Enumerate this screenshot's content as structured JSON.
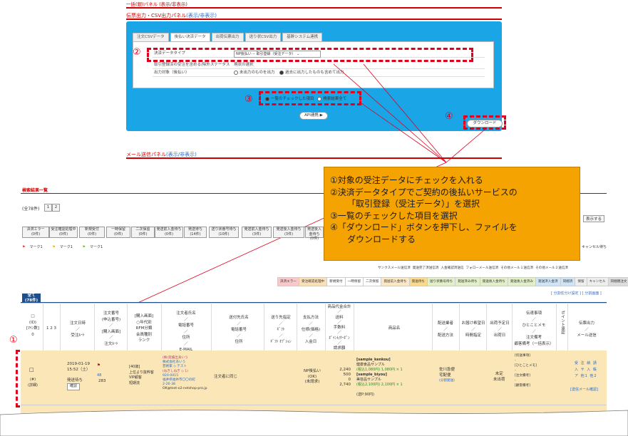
{
  "panels": {
    "top_panel_title": "一括(銀)パネル (表示/非表示)",
    "settle_panel_title": "伝票出力・CSV出力パネル",
    "settle_panel_toggle": "(表示/非表示)",
    "mail_panel_title": "メール送信パネル",
    "mail_panel_toggle": "(表示/非表示)"
  },
  "tabs": [
    "注文CSVデータ",
    "後払い決済データ",
    "出荷伝票出力",
    "送り状CSV出力",
    "基幹システム連携"
  ],
  "form": {
    "settle_type_label": "決済データタイプ",
    "settle_type_value": "NP後払い -- 取引登録（受注データ）",
    "row2_label": "取引登録済の受注を含める/除外ステータス",
    "row2_value": "現状の選択",
    "row3_label": "出力対象（後払い）",
    "opt_unexported": "未出力のものを出力",
    "opt_all": "過去に出力したものも含めて出力",
    "opt_checked": "一覧のチェックした項目",
    "opt_search": "検索結果全て",
    "api_button": "API連携",
    "download_button": "ダウンロード"
  },
  "markers": [
    "①",
    "②",
    "③",
    "④"
  ],
  "callout": {
    "line1": "①対象の受注データにチェックを入れる",
    "line2": "②決済データタイプでご契約の後払いサービスの",
    "line3": "「取引登録（受注データ）」を選択",
    "line4": "③一覧のチェックした項目を選択",
    "line5": "④「ダウンロード」ボタンを押下し、ファイルを",
    "line6": "ダウンロードする"
  },
  "list": {
    "title": "検索結果一覧",
    "count": "(全78件)",
    "pages": [
      "1",
      "2"
    ],
    "display_button": "表示する",
    "status_chips": [
      {
        "name": "決済エラー",
        "count": "(0件)"
      },
      {
        "name": "受注確認処理中",
        "count": "(0件)"
      },
      {
        "name": "新規受付",
        "count": "(0件)"
      },
      {
        "name": "一時保留",
        "count": "(0件)"
      },
      {
        "name": "二次保留",
        "count": "(0件)"
      },
      {
        "name": "発送前入金待ち",
        "count": "(0件)"
      },
      {
        "name": "発送待ち",
        "count": "(14件)"
      },
      {
        "name": "送り状番号待ち",
        "count": "(10件)"
      },
      {
        "name": "発送前入金待ち",
        "count": "(3件)"
      },
      {
        "name": "発送後入金待ち",
        "count": "(3件)"
      },
      {
        "name": "発送後入金待ち",
        "count": "(0件)"
      }
    ],
    "marks": [
      "マーク1",
      "マーク1",
      "マーク1"
    ],
    "right_legend": "キャンセル待ち",
    "mail_links": [
      "サンクスメール送信済",
      "発送完了済送信済",
      "入金確認済送信",
      "フォローメール送信済",
      "その他メール１送信済",
      "その他メール２送信済"
    ],
    "color_strip": [
      "決済エラー",
      "受注確認処理中",
      "新規受付",
      "一時保留",
      "二次保留",
      "発送前入金待ち",
      "発送待ち",
      "送り状番号待ち",
      "発送済み待ち",
      "発送後入金待ち",
      "発送後入金済み",
      "発送済入金済",
      "同梱済",
      "保留",
      "キャンセル",
      "同梱親注文",
      "完了"
    ],
    "split_links": "[ 分割任分け設定 ] [ 分割画面 ]",
    "all_label": "全て",
    "all_count": "(78件)"
  },
  "table_headers": {
    "id": "(ID)",
    "chk": "□",
    "mark": "1 2 3",
    "col1": [
      "注文日時",
      "／",
      "受注ﾙｰﾄ"
    ],
    "col2": [
      "注文番号",
      "(申込番号)",
      "／",
      "[購入画面]",
      "／",
      "注文ﾙｰﾄ"
    ],
    "col3": [
      "[購入画面]",
      "○年代別",
      "RFM分類",
      "会員種別",
      "ランク"
    ],
    "col4": [
      "注文者氏名",
      "／",
      "電話番号",
      "／",
      "住所",
      "／",
      "E-MAIL"
    ],
    "col5": [
      "送付先氏名",
      "／",
      "電話番号",
      "／",
      "住所"
    ],
    "col6": [
      "送り先指定",
      "／",
      "ｷﾞﾌﾄ",
      "／",
      "ｷﾞﾌﾄ ｵﾌﾟｼｮﾝ"
    ],
    "col7": [
      "支払方法",
      "／",
      "仕様(価格)",
      "／",
      "入金日"
    ],
    "col8": [
      "商品代金合計",
      "／",
      "送料",
      "／",
      "手数料",
      "／",
      "ﾎﾟｲﾝﾄ/ｸｰﾎﾟﾝ",
      "／",
      "請求額"
    ],
    "col9": "商品名",
    "col10": [
      "配送業者",
      "／",
      "配送方法"
    ],
    "col11": [
      "お届け希望日",
      "／",
      "時間指定"
    ],
    "col12": [
      "出荷予定日",
      "／",
      "出荷日"
    ],
    "col13": [
      "伝達事項",
      "／",
      "ひとことメモ",
      "／",
      "注文備考",
      "顧客備考（一括表示）"
    ],
    "col14": "ポイント承認",
    "col15": [
      "伝票出力",
      "／",
      "メール送信"
    ]
  },
  "row1": {
    "id": "(#)",
    "id2": "(詳細)",
    "date": "2019-01-19",
    "time": "15:52（土）",
    "route": "発送待ち",
    "route_btn": "確認",
    "order_no": "48",
    "order_no2": "283",
    "rank": [
      "[40歳]",
      "上位より抜粋客",
      "VIP顧客",
      "短期流"
    ],
    "customer": [
      "(株)実績出身いう",
      "株式会社あいう",
      "芸術家 ◇ テスト",
      "(ねぎしねぎ ◇ 1)",
      "920-0015",
      "福井県福井市〇〇の町",
      "2-26-38",
      "OK@test-o2-netshop-pro.jp"
    ],
    "ship_to": "注文者に同じ",
    "pay": [
      "NP後払い",
      "(OK)",
      "(未請求)"
    ],
    "amounts": [
      "2,240",
      "500",
      "0",
      "2,740"
    ],
    "items": [
      "[sample_kenkou]",
      "健康食品サンプル",
      "(税込1,080円) 1,080円 × 1",
      "[sample_biyou]",
      "美容品サンプル",
      "(税込2,100円) 2,100円 × 1",
      "(送P:90円)"
    ],
    "carrier": [
      "佐川急便",
      "宅配便",
      "(分割発送)"
    ],
    "ship_date": [
      "未定",
      "未出荷"
    ],
    "memo": [
      "[伝送事項]",
      "-",
      "[ひとことメモ]",
      "-",
      "[注文備考]",
      "-",
      "[顧客備考]"
    ],
    "print": [
      "受",
      "注",
      "納",
      "請",
      "入",
      "サ",
      "入",
      "帳",
      "ア",
      "他1",
      "他2"
    ],
    "mail_link": "[送信メール確認]"
  }
}
